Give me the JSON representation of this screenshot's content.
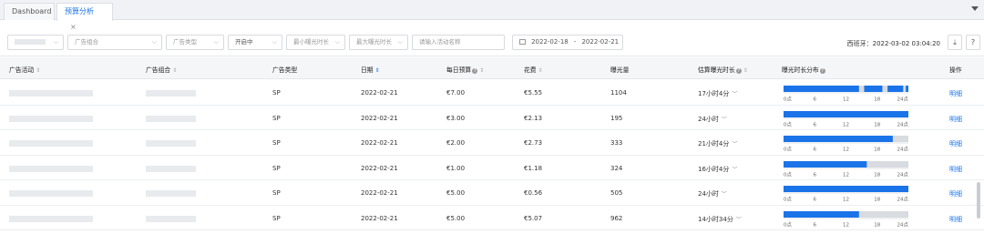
{
  "tabs": [
    {
      "label": "Dashboard"
    },
    {
      "label": "预算分析",
      "close": "×"
    }
  ],
  "filters": {
    "ad_combo": "广告组合",
    "ad_type": "广告类型",
    "status": "开启中",
    "min_exposure": "最小曝光时长",
    "max_exposure": "最大曝光时长",
    "search_placeholder": "请输入活动名称",
    "date_start": "2022-02-18",
    "date_sep": "-",
    "date_end": "2022-02-21",
    "sync_text": "西班牙：2022-03-02 03:04:20"
  },
  "columns": {
    "campaign": "广告活动",
    "combo": "广告组合",
    "type": "广告类型",
    "date": "日期",
    "budget": "每日预算",
    "spend": "花费",
    "impressions": "曝光量",
    "est_duration": "估算曝光时长",
    "distribution": "曝光时长分布",
    "action": "操作"
  },
  "axis_ticks": [
    "0点",
    "6",
    "12",
    "18",
    "24点"
  ],
  "rows": [
    {
      "type": "SP",
      "date": "2022-02-21",
      "budget": "€7.00",
      "spend": "€5.55",
      "impressions": "1104",
      "est": "17小时4分",
      "action": "明细",
      "segments": [
        [
          0,
          14.5
        ],
        [
          15.5,
          19
        ],
        [
          20,
          23
        ],
        [
          23.5,
          24
        ]
      ]
    },
    {
      "type": "SP",
      "date": "2022-02-21",
      "budget": "€3.00",
      "spend": "€2.13",
      "impressions": "195",
      "est": "24小时",
      "action": "明细",
      "segments": [
        [
          0,
          24
        ]
      ]
    },
    {
      "type": "SP",
      "date": "2022-02-21",
      "budget": "€2.00",
      "spend": "€2.73",
      "impressions": "333",
      "est": "21小时4分",
      "action": "明细",
      "segments": [
        [
          0,
          21
        ]
      ]
    },
    {
      "type": "SP",
      "date": "2022-02-21",
      "budget": "€1.00",
      "spend": "€1.18",
      "impressions": "324",
      "est": "16小时4分",
      "action": "明细",
      "segments": [
        [
          0,
          16
        ]
      ]
    },
    {
      "type": "SP",
      "date": "2022-02-21",
      "budget": "€5.00",
      "spend": "€0.56",
      "impressions": "505",
      "est": "24小时",
      "action": "明细",
      "segments": [
        [
          0,
          24
        ]
      ]
    },
    {
      "type": "SP",
      "date": "2022-02-21",
      "budget": "€5.00",
      "spend": "€5.07",
      "impressions": "962",
      "est": "14小时34分",
      "action": "明细",
      "segments": [
        [
          0,
          14.5
        ]
      ]
    }
  ],
  "colors": {
    "accent": "#1a73e8",
    "bar_bg": "#d8dbe0"
  }
}
